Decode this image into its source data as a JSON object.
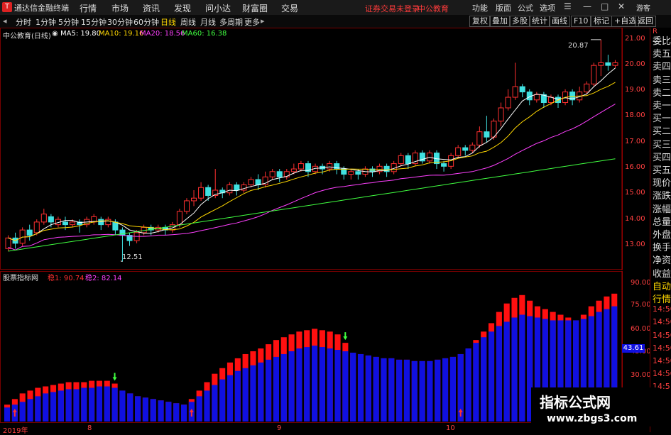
{
  "app": {
    "title": "通达信金融终端",
    "logo": "T"
  },
  "menu": {
    "items": [
      "行情",
      "市场",
      "资讯",
      "发现",
      "问小达",
      "财富圈",
      "交易"
    ]
  },
  "notice": {
    "broker": "证券交易未登录",
    "stock": "中公教育"
  },
  "right_menu": {
    "items": [
      "功能",
      "版面",
      "公式",
      "选项",
      "游客"
    ]
  },
  "window_controls": {
    "minimize": "—",
    "maximize": "□",
    "close": "✕"
  },
  "periods": {
    "items": [
      "分时",
      "1分钟",
      "5分钟",
      "15分钟",
      "30分钟",
      "60分钟",
      "日线",
      "周线",
      "月线",
      "多周期",
      "更多"
    ],
    "active": 6,
    "more_arrow": "▸"
  },
  "tools": {
    "items": [
      "复权",
      "叠加",
      "多股",
      "统计",
      "画线",
      "F10",
      "标记",
      "+自选",
      "返回"
    ]
  },
  "stock_legend": {
    "name": "中公教育(日线)",
    "ma": [
      {
        "label": "MA5: 19.80",
        "color": "#ffffff"
      },
      {
        "label": "MA10: 19.16",
        "color": "#ffd700"
      },
      {
        "label": "MA20: 18.56",
        "color": "#ff40ff"
      },
      {
        "label": "MA60: 16.38",
        "color": "#40ff40"
      }
    ]
  },
  "sub_legend": {
    "name": "股票指标网",
    "lines": [
      {
        "label": "稳1: 90.74",
        "color": "#ff3030"
      },
      {
        "label": "稳2: 82.14",
        "color": "#ff40ff"
      }
    ]
  },
  "right_panel": {
    "header": "R",
    "items": [
      "委比",
      "卖五",
      "卖四",
      "卖三",
      "卖二",
      "卖一",
      "买一",
      "买二",
      "买三",
      "买四",
      "买五",
      "现价",
      "涨跌",
      "涨幅",
      "总量",
      "外盘",
      "换手",
      "净资",
      "收益",
      "自动",
      "行情",
      "14:50",
      "14:50",
      "14:50",
      "14:50",
      "14:50",
      "14:50",
      "14:5"
    ]
  },
  "price_axis": {
    "ticks": [
      "21.00",
      "20.00",
      "19.00",
      "18.00",
      "17.00",
      "16.00",
      "15.00",
      "14.00",
      "13.00"
    ]
  },
  "indicator_axis": {
    "ticks": [
      "90.00",
      "75.00",
      "60.00",
      "45.00",
      "30.00"
    ],
    "current": "43.61"
  },
  "annotations": {
    "high": "20.87",
    "low": "12.51"
  },
  "x_labels": [
    "2019年",
    "8",
    "9",
    "10"
  ],
  "watermark": {
    "line1": "指标公式网",
    "line2": "www.zbgs3.com"
  },
  "colors": {
    "up": "#ff3030",
    "down": "#40e0e0",
    "axis": "#ff4040",
    "blue_bar": "#1010e0",
    "red_bar": "#ff1010"
  },
  "chart_data": {
    "type": "candlestick",
    "y_range": [
      12.5,
      21.0
    ],
    "candles": [
      [
        13.0,
        13.4,
        12.9,
        13.5
      ],
      [
        13.4,
        13.2,
        13.0,
        13.6
      ],
      [
        13.2,
        13.7,
        13.1,
        13.8
      ],
      [
        13.7,
        13.5,
        13.3,
        13.9
      ],
      [
        13.6,
        14.0,
        13.5,
        14.1
      ],
      [
        14.0,
        14.3,
        13.9,
        14.5
      ],
      [
        14.2,
        14.0,
        13.8,
        14.3
      ],
      [
        13.9,
        14.1,
        13.8,
        14.2
      ],
      [
        14.0,
        13.9,
        13.7,
        14.2
      ],
      [
        13.9,
        14.0,
        13.8,
        14.1
      ],
      [
        14.0,
        13.9,
        13.6,
        14.1
      ],
      [
        13.9,
        14.1,
        13.8,
        14.2
      ],
      [
        14.0,
        14.2,
        13.9,
        14.3
      ],
      [
        14.1,
        13.9,
        13.7,
        14.2
      ],
      [
        13.9,
        14.1,
        13.8,
        14.2
      ],
      [
        14.0,
        13.7,
        13.5,
        14.1
      ],
      [
        13.7,
        13.5,
        12.51,
        13.8
      ],
      [
        13.5,
        13.3,
        13.1,
        13.6
      ],
      [
        13.3,
        13.6,
        13.2,
        13.7
      ],
      [
        13.6,
        13.8,
        13.5,
        13.9
      ],
      [
        13.8,
        13.7,
        13.5,
        13.9
      ],
      [
        13.7,
        13.8,
        13.6,
        13.9
      ],
      [
        13.8,
        13.7,
        13.5,
        13.9
      ],
      [
        13.7,
        13.9,
        13.6,
        14.0
      ],
      [
        13.9,
        14.4,
        13.8,
        14.5
      ],
      [
        14.4,
        14.8,
        14.3,
        14.9
      ],
      [
        14.8,
        14.9,
        14.6,
        15.2
      ],
      [
        14.9,
        15.3,
        14.8,
        15.5
      ],
      [
        15.3,
        15.0,
        14.8,
        15.4
      ],
      [
        15.0,
        15.2,
        14.9,
        16.0
      ],
      [
        15.2,
        15.1,
        14.9,
        15.3
      ],
      [
        15.1,
        15.4,
        15.0,
        15.5
      ],
      [
        15.4,
        15.2,
        15.0,
        15.5
      ],
      [
        15.2,
        15.4,
        15.1,
        15.5
      ],
      [
        15.4,
        15.6,
        15.3,
        15.7
      ],
      [
        15.6,
        15.4,
        15.2,
        15.8
      ],
      [
        15.4,
        15.7,
        15.3,
        15.9
      ],
      [
        15.7,
        15.9,
        15.6,
        16.0
      ],
      [
        15.9,
        15.7,
        15.5,
        16.0
      ],
      [
        15.7,
        15.9,
        15.6,
        16.0
      ],
      [
        15.9,
        16.0,
        15.8,
        16.2
      ],
      [
        16.0,
        16.2,
        15.9,
        16.3
      ],
      [
        16.2,
        15.9,
        15.7,
        16.3
      ],
      [
        15.9,
        16.1,
        15.8,
        16.2
      ],
      [
        16.1,
        16.0,
        15.8,
        16.2
      ],
      [
        16.0,
        16.2,
        15.9,
        16.3
      ],
      [
        16.2,
        16.0,
        15.8,
        16.3
      ],
      [
        16.0,
        15.8,
        15.6,
        16.1
      ],
      [
        15.8,
        15.9,
        15.6,
        16.0
      ],
      [
        15.9,
        15.8,
        15.6,
        16.0
      ],
      [
        15.8,
        16.0,
        15.7,
        16.1
      ],
      [
        16.0,
        15.9,
        15.7,
        16.1
      ],
      [
        15.9,
        16.1,
        15.8,
        16.2
      ],
      [
        16.1,
        15.9,
        15.7,
        16.2
      ],
      [
        15.9,
        16.2,
        15.8,
        16.3
      ],
      [
        16.2,
        16.5,
        16.1,
        16.6
      ],
      [
        16.5,
        16.2,
        16.0,
        16.6
      ],
      [
        16.2,
        16.6,
        16.1,
        16.7
      ],
      [
        16.6,
        16.3,
        16.2,
        16.7
      ],
      [
        16.3,
        16.6,
        16.2,
        16.7
      ],
      [
        16.6,
        16.2,
        16.0,
        16.7
      ],
      [
        16.2,
        16.1,
        15.9,
        16.3
      ],
      [
        16.1,
        16.5,
        16.0,
        16.6
      ],
      [
        16.5,
        16.8,
        16.4,
        16.9
      ],
      [
        16.8,
        16.7,
        16.5,
        16.9
      ],
      [
        16.7,
        16.9,
        16.6,
        17.0
      ],
      [
        16.9,
        17.4,
        16.8,
        17.6
      ],
      [
        17.4,
        17.2,
        17.0,
        18.0
      ],
      [
        17.2,
        17.8,
        17.1,
        17.9
      ],
      [
        17.8,
        18.3,
        17.6,
        18.5
      ],
      [
        18.3,
        18.7,
        18.2,
        19.0
      ],
      [
        18.7,
        19.1,
        18.6,
        20.0
      ],
      [
        19.1,
        18.9,
        18.7,
        19.2
      ],
      [
        18.9,
        18.6,
        18.4,
        19.0
      ],
      [
        18.6,
        18.8,
        18.5,
        18.9
      ],
      [
        18.8,
        18.5,
        18.3,
        18.9
      ],
      [
        18.5,
        18.7,
        18.4,
        18.8
      ],
      [
        18.7,
        18.5,
        18.3,
        18.8
      ],
      [
        18.5,
        18.9,
        18.4,
        19.0
      ],
      [
        18.9,
        18.6,
        18.4,
        19.0
      ],
      [
        18.6,
        18.9,
        18.5,
        19.1
      ],
      [
        18.9,
        19.2,
        18.8,
        19.3
      ],
      [
        19.2,
        19.9,
        19.1,
        20.0
      ],
      [
        19.9,
        20.0,
        19.5,
        20.87
      ],
      [
        20.0,
        19.9,
        19.7,
        20.3
      ],
      [
        19.9,
        20.0,
        19.8,
        20.1
      ]
    ],
    "indicator": {
      "y_range": [
        0,
        100
      ],
      "blue": [
        10,
        12,
        14,
        16,
        18,
        20,
        21,
        22,
        23,
        23,
        24,
        24,
        25,
        25,
        24,
        22,
        20,
        18,
        17,
        16,
        15,
        14,
        13,
        12,
        14,
        18,
        22,
        26,
        30,
        33,
        36,
        38,
        40,
        42,
        44,
        46,
        48,
        50,
        52,
        53,
        54,
        53,
        52,
        51,
        50,
        49,
        48,
        47,
        46,
        45,
        45,
        44,
        44,
        43,
        43,
        43,
        44,
        45,
        46,
        48,
        52,
        56,
        60,
        64,
        68,
        71,
        74,
        76,
        75,
        74,
        73,
        72,
        72,
        72,
        72,
        73,
        75,
        78,
        80,
        82
      ],
      "red": [
        12,
        16,
        20,
        22,
        24,
        25,
        26,
        27,
        28,
        28,
        28,
        29,
        29,
        29,
        27,
        22,
        20,
        18,
        17,
        16,
        15,
        14,
        13,
        12,
        16,
        22,
        28,
        34,
        38,
        42,
        45,
        48,
        50,
        52,
        55,
        58,
        60,
        62,
        64,
        65,
        66,
        65,
        64,
        62,
        56,
        49,
        48,
        47,
        46,
        45,
        45,
        44,
        44,
        43,
        43,
        43,
        44,
        45,
        46,
        48,
        52,
        58,
        64,
        70,
        78,
        84,
        88,
        90,
        86,
        82,
        80,
        78,
        76,
        74,
        72,
        76,
        82,
        86,
        89,
        91
      ]
    }
  }
}
